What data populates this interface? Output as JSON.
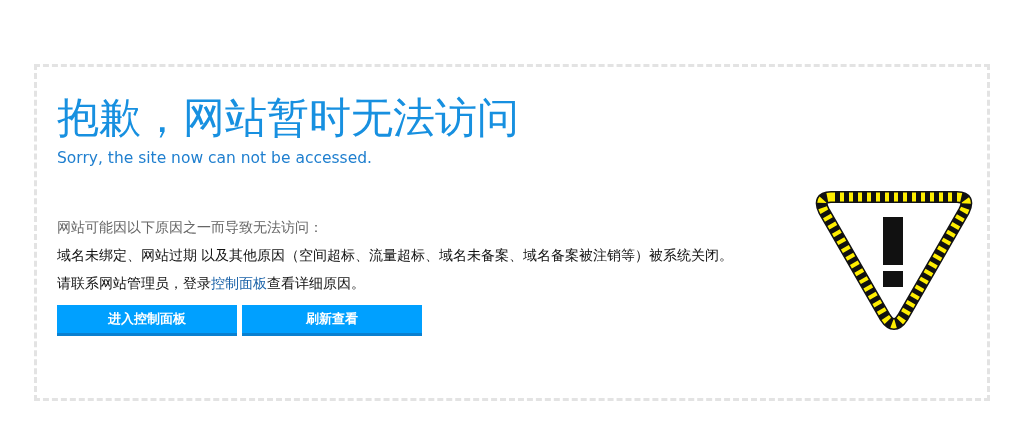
{
  "title": "抱歉，网站暂时无法访问",
  "subtitle": "Sorry, the site now can not be accessed.",
  "intro": "网站可能因以下原因之一而导致无法访问：",
  "reasons": "域名未绑定、网站过期 以及其他原因（空间超标、流量超标、域名未备案、域名备案被注销等）被系统关闭。",
  "contact": {
    "before": "请联系网站管理员，登录",
    "link": "控制面板",
    "after": "查看详细原因。"
  },
  "buttons": [
    {
      "label": "进入控制面板"
    },
    {
      "label": "刷新查看"
    }
  ]
}
